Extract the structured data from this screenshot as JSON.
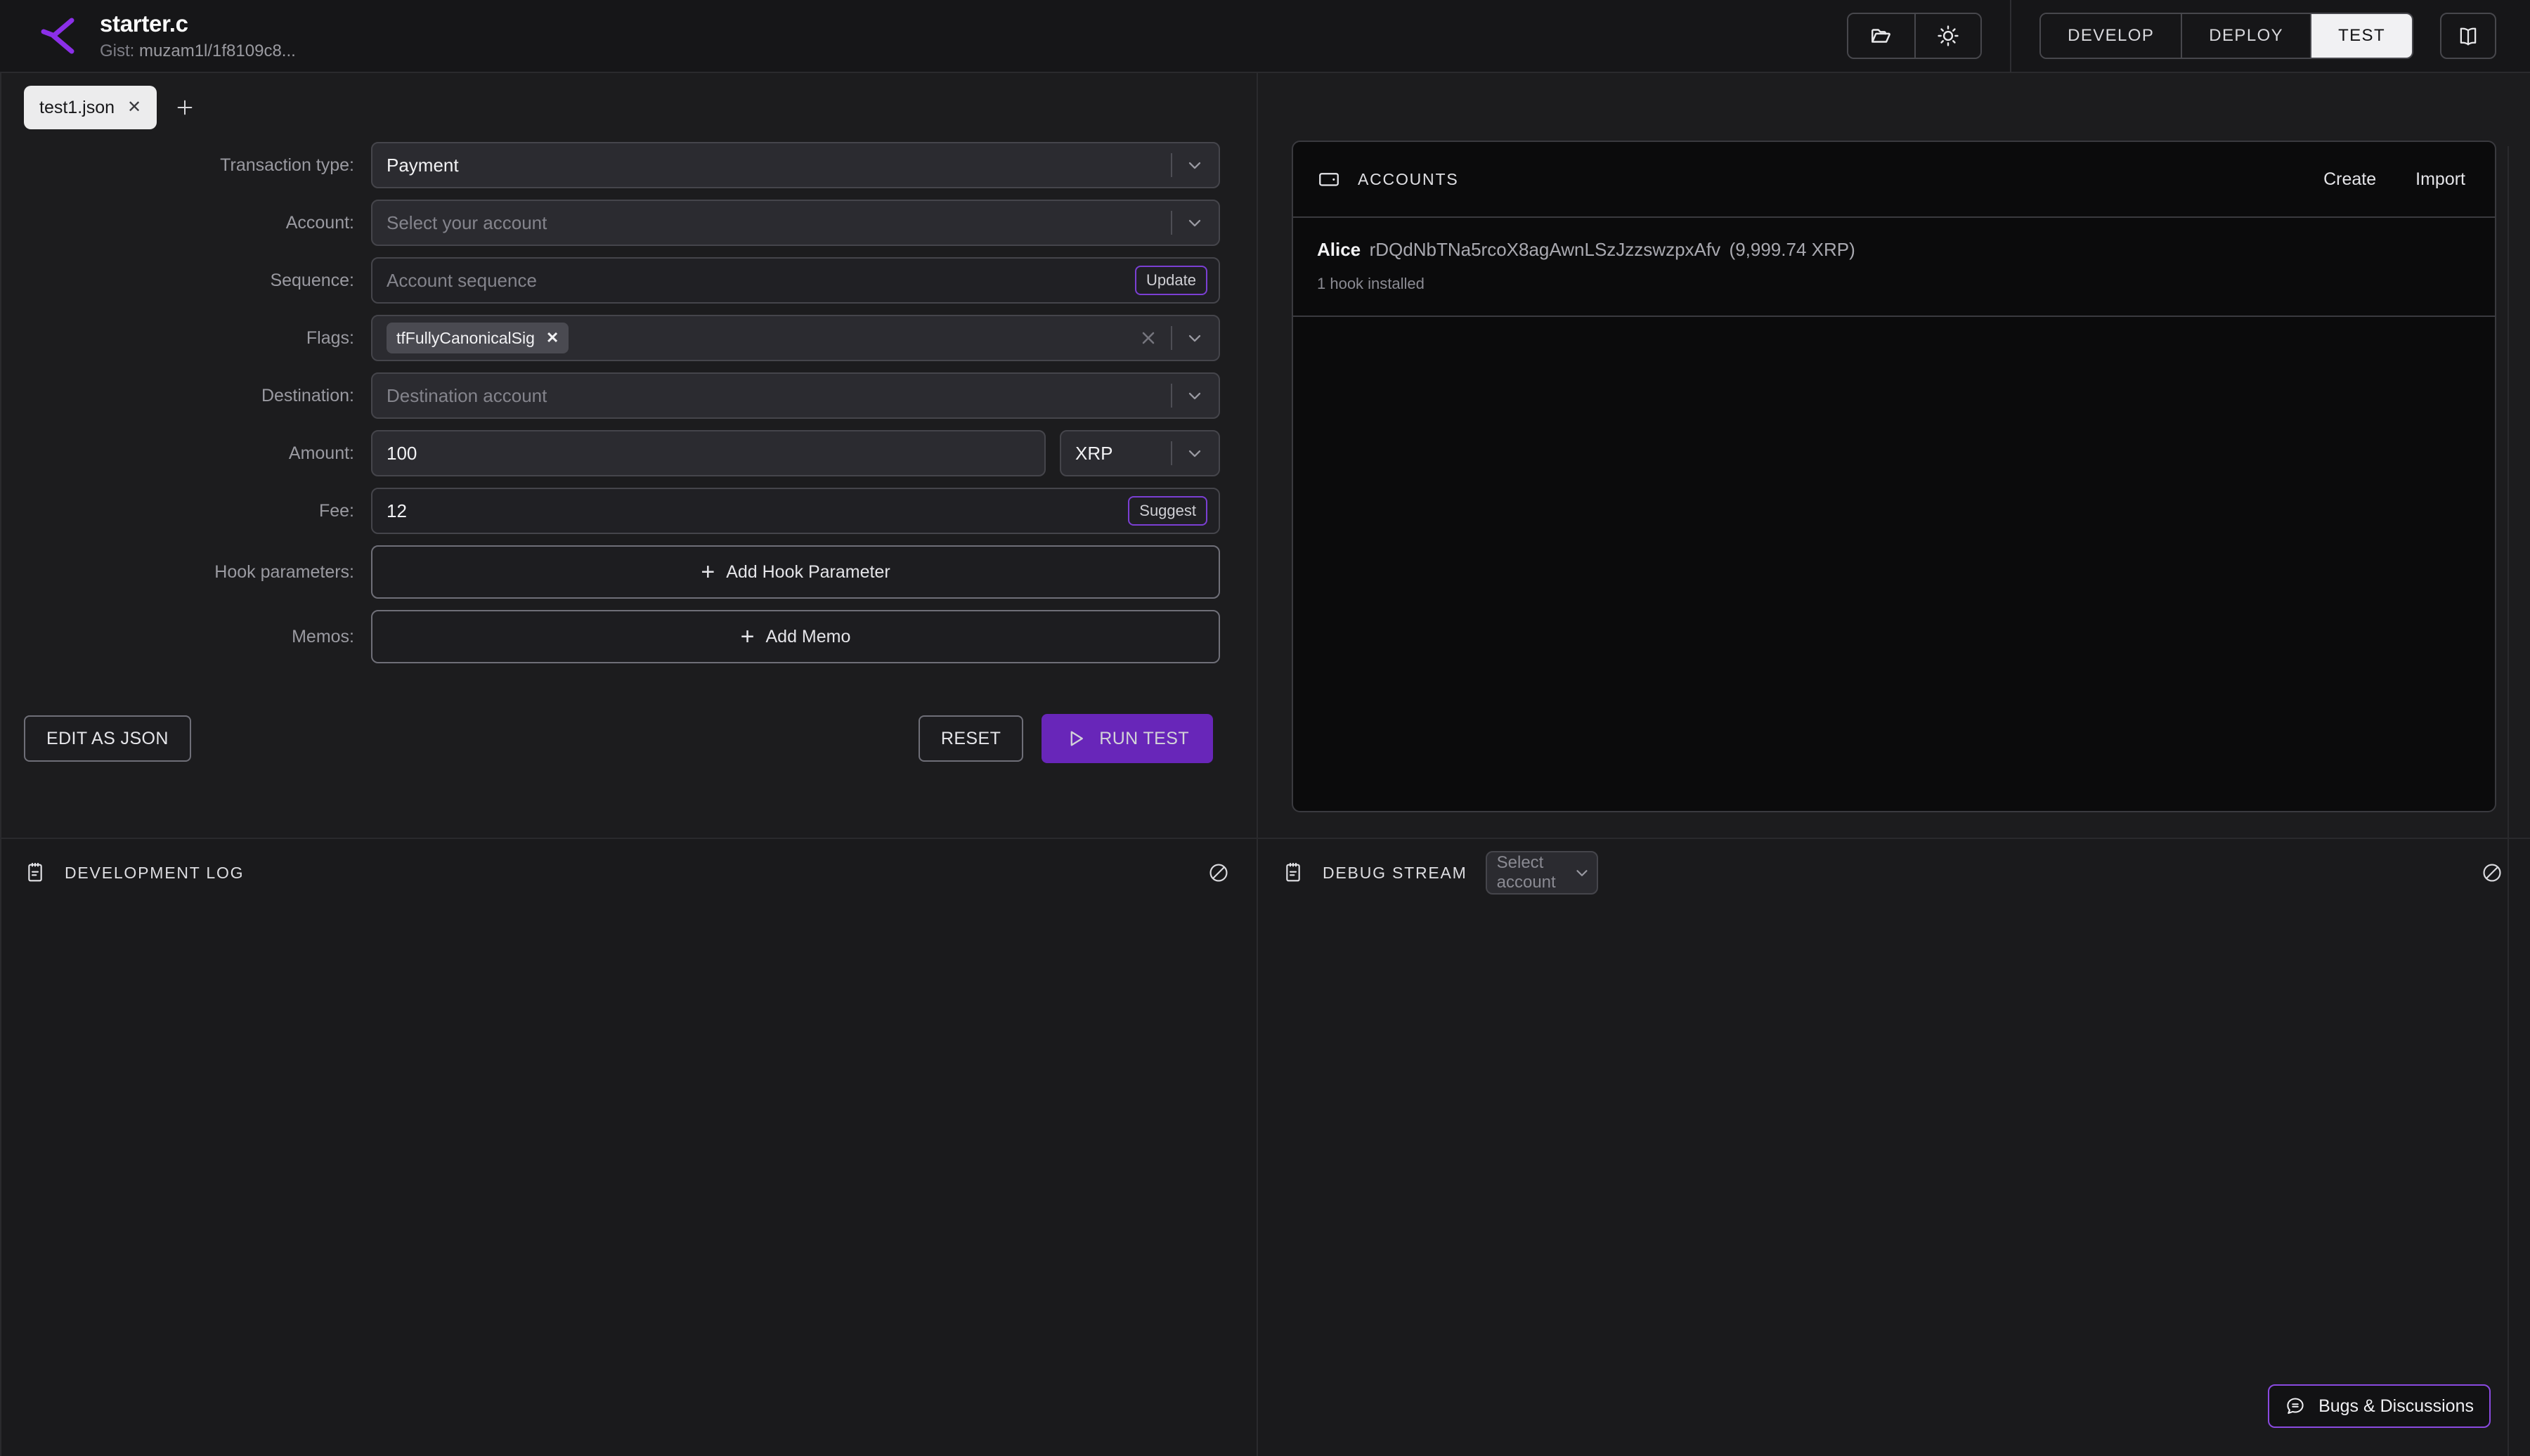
{
  "header": {
    "logo_icon": "hooks-logo-icon",
    "file_title": "starter.c",
    "gist_label": "Gist:",
    "gist_value": "muzam1l/1f8109c8...",
    "open_folder_icon": "folder-open-icon",
    "theme_icon": "brightness-sun-icon",
    "docs_icon": "book-icon",
    "modes": [
      {
        "label": "DEVELOP",
        "active": false
      },
      {
        "label": "DEPLOY",
        "active": false
      },
      {
        "label": "TEST",
        "active": true
      }
    ]
  },
  "tabs": {
    "items": [
      {
        "label": "test1.json",
        "close_icon": "close-icon",
        "active": true
      }
    ],
    "add_icon": "plus-icon"
  },
  "form": {
    "rows": {
      "transaction_type": {
        "label": "Transaction type:",
        "value": "Payment",
        "chevron_icon": "chevron-down-icon"
      },
      "account": {
        "label": "Account:",
        "placeholder": "Select your account",
        "chevron_icon": "chevron-down-icon"
      },
      "sequence": {
        "label": "Sequence:",
        "placeholder": "Account sequence",
        "button": "Update"
      },
      "flags": {
        "label": "Flags:",
        "chip": "tfFullyCanonicalSig",
        "chip_remove_icon": "chip-close-icon",
        "clear_icon": "clear-x-icon",
        "chevron_icon": "chevron-down-icon"
      },
      "destination": {
        "label": "Destination:",
        "placeholder": "Destination account",
        "chevron_icon": "chevron-down-icon"
      },
      "amount": {
        "label": "Amount:",
        "value": "100",
        "currency": "XRP",
        "chevron_icon": "chevron-down-icon"
      },
      "fee": {
        "label": "Fee:",
        "value": "12",
        "button": "Suggest"
      },
      "hook_parameters": {
        "label": "Hook parameters:",
        "add_label": "Add Hook Parameter",
        "plus_icon": "plus-icon"
      },
      "memos": {
        "label": "Memos:",
        "add_label": "Add Memo",
        "plus_icon": "plus-icon"
      }
    }
  },
  "actions": {
    "edit_json": "EDIT AS JSON",
    "reset": "RESET",
    "run_test": "RUN TEST",
    "run_icon": "play-triangle-icon"
  },
  "development_log": {
    "icon": "log-notepad-icon",
    "title": "DEVELOPMENT LOG",
    "clear_icon": "no-entry-clear-icon"
  },
  "debug_stream": {
    "icon": "log-notepad-icon",
    "title": "DEBUG STREAM",
    "select_placeholder": "Select account",
    "chevron_icon": "chevron-down-icon",
    "clear_icon": "no-entry-clear-icon"
  },
  "accounts": {
    "icon": "wallet-icon",
    "title": "ACCOUNTS",
    "create_label": "Create",
    "import_label": "Import",
    "rows": [
      {
        "name": "Alice",
        "address": "rDQdNbTNa5rcoX8agAwnLSzJzzswzpxAfv",
        "balance": "(9,999.74 XRP)",
        "sub": "1 hook installed"
      }
    ]
  },
  "bugs": {
    "label": "Bugs & Discussions",
    "icon": "chat-bubble-icon"
  },
  "colors": {
    "accent_purple": "#6826b9",
    "accent_outline": "#8a4ae0",
    "page_bg": "#1c1c1e",
    "panel_bg": "#0b0b0c",
    "active_tab_bg": "#ececed"
  }
}
